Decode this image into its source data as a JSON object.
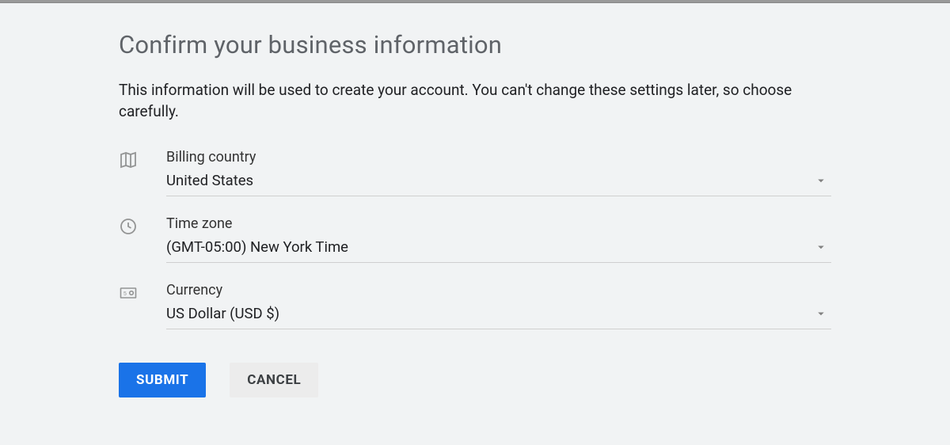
{
  "header": {
    "title": "Confirm your business information",
    "subtitle": "This information will be used to create your account. You can't change these settings later, so choose carefully."
  },
  "fields": {
    "billing_country": {
      "label": "Billing country",
      "value": "United States"
    },
    "time_zone": {
      "label": "Time zone",
      "value": "(GMT-05:00) New York Time"
    },
    "currency": {
      "label": "Currency",
      "value": "US Dollar (USD $)"
    }
  },
  "actions": {
    "submit": "SUBMIT",
    "cancel": "CANCEL"
  }
}
